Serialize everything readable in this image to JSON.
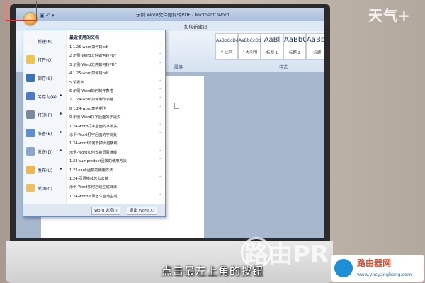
{
  "title_bar": {
    "title": "示例 Word文件如何转PDF - Microsoft Word"
  },
  "tab_bar": {
    "tab": "如何新建记"
  },
  "ribbon": {
    "group_paragraph": "段落",
    "group_styles": "样式",
    "styles": [
      {
        "sample": "AaBbCcDd",
        "name": "↵ 正文"
      },
      {
        "sample": "AaBbCcDd",
        "name": "↵ 无间隔"
      },
      {
        "sample": "AaBl",
        "name": "标题 1"
      },
      {
        "sample": "AaBbC",
        "name": "标题 2"
      },
      {
        "sample": "AaBbC",
        "name": "标题"
      }
    ]
  },
  "office_menu": {
    "commands": [
      {
        "label": "新建(N)",
        "color": "#f5f5f5"
      },
      {
        "label": "打开(O)",
        "color": "#f2c24a"
      },
      {
        "label": "保存(S)",
        "color": "#3a6fc4"
      },
      {
        "label": "另存为(A)",
        "color": "#4a7ad0",
        "arrow": "▸"
      },
      {
        "label": "打印(P)",
        "color": "#7a8aa0",
        "arrow": "▸"
      },
      {
        "label": "准备(E)",
        "color": "#5c8fd6",
        "arrow": "▸"
      },
      {
        "label": "发送(D)",
        "color": "#8aa6cf",
        "arrow": "▸"
      },
      {
        "label": "发布(U)",
        "color": "#f0b64a",
        "arrow": "▸"
      },
      {
        "label": "关闭(C)",
        "color": "#f0c060"
      }
    ],
    "recent_title": "最近使用的文档",
    "recent": [
      "1 1.25-word如何转pdf",
      "2 示例-Word文件如何转PDF",
      "3 示例-Word文件如何转PDF",
      "4 1.25-word如何转pdf",
      "5 设置表",
      "6 示例-Word如何制作表格",
      "7 1.24-word如何制作表格",
      "8 1.24-word表格制作",
      "9 示例-Word打字后面的字消失",
      "1.24-word打字后面的字消失",
      "示例-Word打字后面的字消失",
      "1.24-word如何去掉页眉横线",
      "示例-Word如何去掉页眉横线",
      "1.22-sumproduct函数的使用方法",
      "1.22-rank函数的使用方法",
      "1.24-页眉横线怎么去掉",
      "示例-Word如何自动生成目录",
      "1.24-word目录怎么自动生成"
    ],
    "options_button": "Word 选项(I)",
    "exit_button": "退出 Word(X)"
  },
  "qat": {
    "symbols": "▣ ↶ ▾"
  },
  "subtitle": "点击最左上角的按钮",
  "brand": "天气+",
  "watermark": "路由PR",
  "site": {
    "name": "路由器网",
    "url": "www.yncyangbang.com"
  }
}
